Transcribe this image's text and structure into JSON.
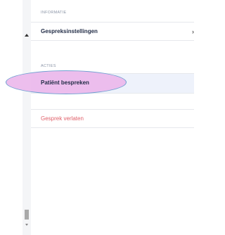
{
  "sections": {
    "info_label": "INFORMATIE",
    "actions_label": "ACTIES"
  },
  "items": {
    "settings": "Gespreksinstellingen",
    "discuss_patient": "Patiënt bespreken",
    "leave_call": "Gesprek verlaten"
  },
  "icons": {
    "settings_chevron": "chevron-right-icon"
  },
  "colors": {
    "section_label": "#8a94a6",
    "item_text": "#1f2a44",
    "leave_text": "#e0606a",
    "highlight_fill": "#ecb9ec",
    "highlight_stroke": "#6f9fd1",
    "selected_row_bg": "#eef2fb"
  }
}
